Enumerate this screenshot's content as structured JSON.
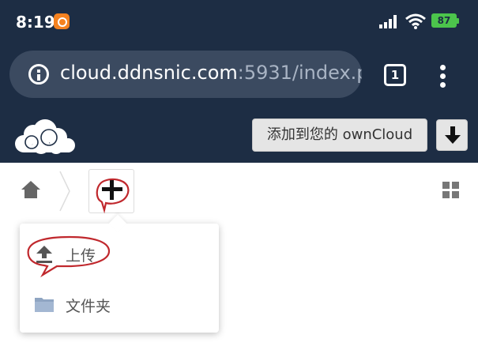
{
  "status_bar": {
    "time": "8:19",
    "battery": "87",
    "accent": "#f58220",
    "battery_color": "#4cc44c"
  },
  "browser": {
    "url_host": "cloud.ddnsnic.com",
    "url_rest": ":5931/index.p",
    "tab_count": "1",
    "bar_color": "#1d2d44",
    "url_box_color": "#3b4a60"
  },
  "owncloud_header": {
    "logo_icon": "owncloud-cloud-logo",
    "add_button_label": "添加到您的 ownCloud",
    "download_icon": "download-arrow-icon"
  },
  "file_controls": {
    "home_icon": "home-icon",
    "new_button_icon": "plus-icon",
    "view_toggle_icon": "grid-view-icon"
  },
  "new_menu": {
    "items": [
      {
        "label": "上传",
        "icon": "upload-icon"
      },
      {
        "label": "文件夹",
        "icon": "folder-icon"
      }
    ]
  },
  "annotations": {
    "color": "#c0282d"
  }
}
